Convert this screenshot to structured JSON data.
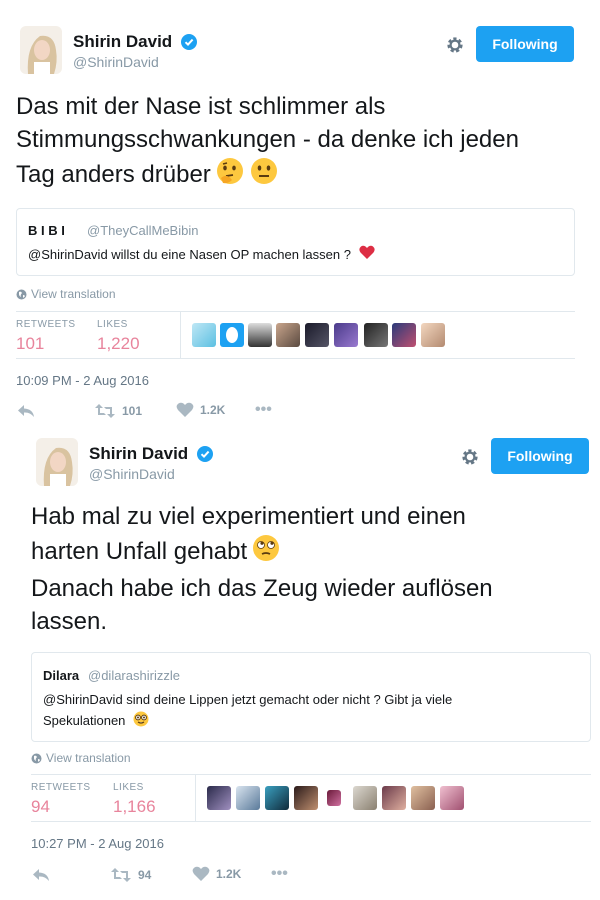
{
  "tweets": [
    {
      "author": {
        "name": "Shirin David",
        "handle": "@ShirinDavid"
      },
      "follow_label": "Following",
      "text_lines": [
        "Das mit der Nase ist schlimmer als",
        "Stimmungsschwankungen - da denke ich jeden",
        "Tag anders drüber"
      ],
      "emojis": [
        "thinking-face",
        "neutral-face"
      ],
      "quote": {
        "name": "B I B I",
        "handle": "@TheyCallMeBibin",
        "text_lines": [
          "@ShirinDavid willst du eine Nasen OP machen lassen ?"
        ],
        "emoji": "red-heart"
      },
      "view_translation": "View translation",
      "stats": {
        "retweets_label": "RETWEETS",
        "retweets": "101",
        "likes_label": "LIKES",
        "likes": "1,220"
      },
      "likers_count": 10,
      "timestamp": "10:09 PM - 2 Aug 2016",
      "actions": {
        "retweets": "101",
        "likes": "1.2K",
        "more": "•••"
      }
    },
    {
      "author": {
        "name": "Shirin David",
        "handle": "@ShirinDavid"
      },
      "follow_label": "Following",
      "text_lines": [
        "Hab mal zu viel experimentiert und einen",
        "harten Unfall gehabt",
        "Danach habe ich das Zeug wieder auflösen",
        "lassen."
      ],
      "emojis": [
        "face-with-rolling-eyes"
      ],
      "quote": {
        "name": "Dilara",
        "handle": "@dilarashirizzle",
        "text_lines": [
          "@ShirinDavid sind deine Lippen jetzt gemacht oder nicht ? Gibt ja viele",
          "Spekulationen"
        ],
        "emoji": "nerd-face"
      },
      "view_translation": "View translation",
      "stats": {
        "retweets_label": "RETWEETS",
        "retweets": "94",
        "likes_label": "LIKES",
        "likes": "1,166"
      },
      "likers_count": 10,
      "timestamp": "10:27 PM - 2 Aug 2016",
      "actions": {
        "retweets": "94",
        "likes": "1.2K",
        "more": "•••"
      }
    }
  ],
  "colors": {
    "accent": "#1da1f2",
    "stat_value": "#e8849c",
    "muted": "#8899a6",
    "border": "#e1e8ed"
  }
}
